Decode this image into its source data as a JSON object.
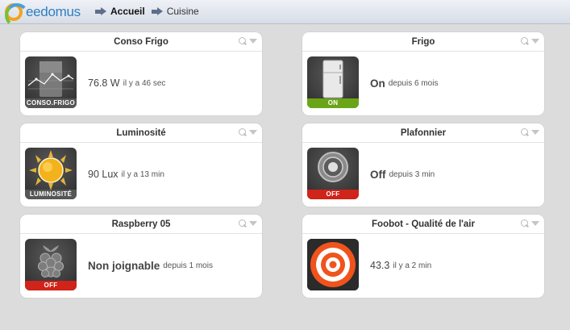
{
  "header": {
    "logo_text": "eedomus",
    "breadcrumb": [
      {
        "label": "Accueil"
      },
      {
        "label": "Cuisine"
      }
    ]
  },
  "cards": [
    {
      "title": "Conso Frigo",
      "value": "76.8 W",
      "since": "il y a 46 sec",
      "thumb_label": "CONSO.FRIGO",
      "icon": "power-graph-icon"
    },
    {
      "title": "Frigo",
      "value": "On",
      "since": "depuis 6 mois",
      "thumb_label": "ON",
      "icon": "fridge-icon"
    },
    {
      "title": "Luminosité",
      "value": "90 Lux",
      "since": "il y a 13 min",
      "thumb_label": "LUMINOSITÉ",
      "icon": "sun-icon"
    },
    {
      "title": "Plafonnier",
      "value": "Off",
      "since": "depuis 3 min",
      "thumb_label": "OFF",
      "icon": "ceiling-light-icon"
    },
    {
      "title": "Raspberry 05",
      "value": "Non joignable",
      "since": "depuis 1 mois",
      "thumb_label": "OFF",
      "icon": "raspberry-icon"
    },
    {
      "title": "Foobot - Qualité de l'air",
      "value": "43.3",
      "since": "il y a 2 min",
      "icon": "target-icon"
    }
  ],
  "colors": {
    "label_green": "#6aa517",
    "label_red": "#d0231a",
    "label_gray": "#555555",
    "target_orange": "#f0531c"
  }
}
